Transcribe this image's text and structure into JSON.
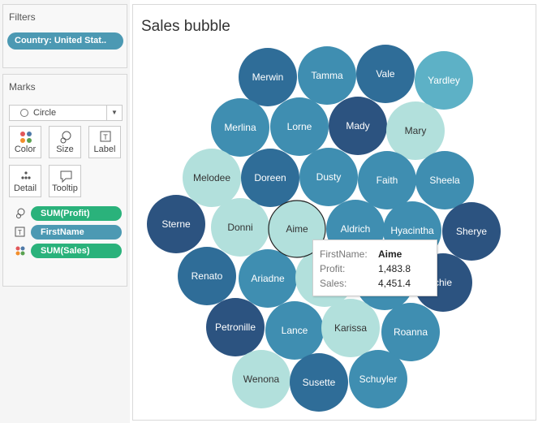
{
  "filters": {
    "title": "Filters",
    "pill": "Country: United Stat.."
  },
  "marks": {
    "title": "Marks",
    "mark_type": "Circle",
    "buttons": {
      "color": "Color",
      "size": "Size",
      "label": "Label",
      "detail": "Detail",
      "tooltip": "Tooltip"
    },
    "fields": [
      {
        "icon": "size-icon",
        "label": "SUM(Profit)",
        "color": "#2ab27b"
      },
      {
        "icon": "label-icon",
        "label": "FirstName",
        "color": "#4c99b3"
      },
      {
        "icon": "color-icon",
        "label": "SUM(Sales)",
        "color": "#2ab27b"
      }
    ]
  },
  "sheet": {
    "title": "Sales bubble"
  },
  "colors": {
    "very_light": "#b2e0dc",
    "light": "#5db1c6",
    "mid": "#3f8eb1",
    "dark": "#2f6d98",
    "darkest": "#2c5380",
    "selected_border": "#222222"
  },
  "chart_data": {
    "type": "bubble",
    "size_measure": "SUM(Profit)",
    "color_measure": "SUM(Sales)",
    "label_field": "FirstName",
    "bubbles": [
      {
        "name": "Merwin",
        "shade": "dark"
      },
      {
        "name": "Tamma",
        "shade": "mid"
      },
      {
        "name": "Vale",
        "shade": "dark"
      },
      {
        "name": "Yardley",
        "shade": "light"
      },
      {
        "name": "Merlina",
        "shade": "mid"
      },
      {
        "name": "Lorne",
        "shade": "mid"
      },
      {
        "name": "Mady",
        "shade": "darkest"
      },
      {
        "name": "Mary",
        "shade": "very_light"
      },
      {
        "name": "Melodee",
        "shade": "very_light"
      },
      {
        "name": "Doreen",
        "shade": "dark"
      },
      {
        "name": "Dusty",
        "shade": "mid"
      },
      {
        "name": "Faith",
        "shade": "mid"
      },
      {
        "name": "Sheela",
        "shade": "mid"
      },
      {
        "name": "Sterne",
        "shade": "darkest"
      },
      {
        "name": "Donni",
        "shade": "very_light"
      },
      {
        "name": "Aime",
        "shade": "very_light",
        "selected": true
      },
      {
        "name": "Aldrich",
        "shade": "mid"
      },
      {
        "name": "Hyacintha",
        "shade": "mid"
      },
      {
        "name": "Sherye",
        "shade": "darkest"
      },
      {
        "name": "Renato",
        "shade": "dark"
      },
      {
        "name": "Ariadne",
        "shade": "mid"
      },
      {
        "name": "A",
        "shade": "very_light"
      },
      {
        "name": "",
        "shade": "mid"
      },
      {
        "name": "chie",
        "shade": "darkest"
      },
      {
        "name": "Petronille",
        "shade": "darkest"
      },
      {
        "name": "Lance",
        "shade": "mid"
      },
      {
        "name": "Karissa",
        "shade": "very_light"
      },
      {
        "name": "Roanna",
        "shade": "mid"
      },
      {
        "name": "Wenona",
        "shade": "very_light"
      },
      {
        "name": "Susette",
        "shade": "dark"
      },
      {
        "name": "Schuyler",
        "shade": "mid"
      }
    ]
  },
  "tooltip": {
    "rows": [
      {
        "key": "FirstName:",
        "value": "Aime"
      },
      {
        "key": "Profit:",
        "value": "1,483.8"
      },
      {
        "key": "Sales:",
        "value": "4,451.4"
      }
    ]
  }
}
